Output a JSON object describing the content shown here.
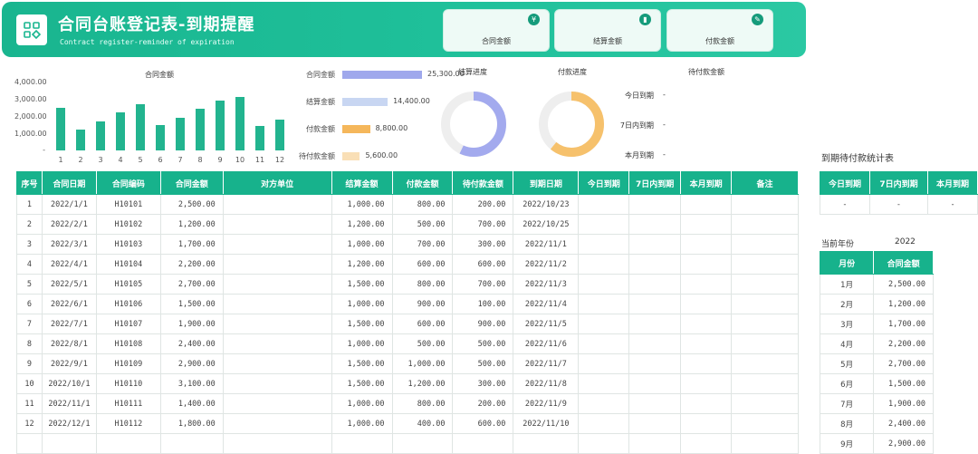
{
  "header": {
    "title": "合同台账登记表-到期提醒",
    "subtitle": "Contract register-reminder of expiration",
    "kpis": [
      {
        "label": "合同金额",
        "icon": "yen-icon"
      },
      {
        "label": "结算金额",
        "icon": "bar-chart-icon"
      },
      {
        "label": "付款金额",
        "icon": "edit-icon"
      }
    ]
  },
  "bar_chart": {
    "title": "合同金额",
    "yticks": [
      "4,000.00",
      "3,000.00",
      "2,000.00",
      "1,000.00",
      "-"
    ],
    "chart_data": {
      "type": "bar",
      "categories": [
        "1",
        "2",
        "3",
        "4",
        "5",
        "6",
        "7",
        "8",
        "9",
        "10",
        "11",
        "12"
      ],
      "values": [
        2500,
        1200,
        1700,
        2200,
        2700,
        1500,
        1900,
        2400,
        2900,
        3100,
        1400,
        1800
      ],
      "ylim": [
        0,
        4000
      ]
    }
  },
  "hbar_chart": {
    "items": [
      {
        "label": "合同金额",
        "value": "25,300.00",
        "num": 25300,
        "color": "#9fa8ec"
      },
      {
        "label": "结算金额",
        "value": "14,400.00",
        "num": 14400,
        "color": "#c8d6f2"
      },
      {
        "label": "付款金额",
        "value": "8,800.00",
        "num": 8800,
        "color": "#f5b75b"
      },
      {
        "label": "待付款金额",
        "value": "5,600.00",
        "num": 5600,
        "color": "#f9dfb6"
      }
    ]
  },
  "donuts": {
    "settle_title": "结算进度",
    "pay_title": "付款进度",
    "settle_ratio": 0.57,
    "pay_ratio": 0.61,
    "settle_color": "#a3aaee",
    "pay_color": "#f6c16c"
  },
  "pending": {
    "title": "待付款金额",
    "rows": [
      {
        "label": "今日到期",
        "value": "-"
      },
      {
        "label": "7日内到期",
        "value": "-"
      },
      {
        "label": "本月到期",
        "value": "-"
      }
    ]
  },
  "main_table": {
    "headers": [
      "序号",
      "合同日期",
      "合同编码",
      "合同金额",
      "对方单位",
      "结算金额",
      "付款金额",
      "待付款金额",
      "到期日期",
      "今日到期",
      "7日内到期",
      "本月到期",
      "备注"
    ],
    "rows": [
      [
        "1",
        "2022/1/1",
        "H10101",
        "2,500.00",
        "",
        "1,000.00",
        "800.00",
        "200.00",
        "2022/10/23",
        "",
        "",
        "",
        ""
      ],
      [
        "2",
        "2022/2/1",
        "H10102",
        "1,200.00",
        "",
        "1,200.00",
        "500.00",
        "700.00",
        "2022/10/25",
        "",
        "",
        "",
        ""
      ],
      [
        "3",
        "2022/3/1",
        "H10103",
        "1,700.00",
        "",
        "1,000.00",
        "700.00",
        "300.00",
        "2022/11/1",
        "",
        "",
        "",
        ""
      ],
      [
        "4",
        "2022/4/1",
        "H10104",
        "2,200.00",
        "",
        "1,200.00",
        "600.00",
        "600.00",
        "2022/11/2",
        "",
        "",
        "",
        ""
      ],
      [
        "5",
        "2022/5/1",
        "H10105",
        "2,700.00",
        "",
        "1,500.00",
        "800.00",
        "700.00",
        "2022/11/3",
        "",
        "",
        "",
        ""
      ],
      [
        "6",
        "2022/6/1",
        "H10106",
        "1,500.00",
        "",
        "1,000.00",
        "900.00",
        "100.00",
        "2022/11/4",
        "",
        "",
        "",
        ""
      ],
      [
        "7",
        "2022/7/1",
        "H10107",
        "1,900.00",
        "",
        "1,500.00",
        "600.00",
        "900.00",
        "2022/11/5",
        "",
        "",
        "",
        ""
      ],
      [
        "8",
        "2022/8/1",
        "H10108",
        "2,400.00",
        "",
        "1,000.00",
        "500.00",
        "500.00",
        "2022/11/6",
        "",
        "",
        "",
        ""
      ],
      [
        "9",
        "2022/9/1",
        "H10109",
        "2,900.00",
        "",
        "1,500.00",
        "1,000.00",
        "500.00",
        "2022/11/7",
        "",
        "",
        "",
        ""
      ],
      [
        "10",
        "2022/10/1",
        "H10110",
        "3,100.00",
        "",
        "1,500.00",
        "1,200.00",
        "300.00",
        "2022/11/8",
        "",
        "",
        "",
        ""
      ],
      [
        "11",
        "2022/11/1",
        "H10111",
        "1,400.00",
        "",
        "1,000.00",
        "800.00",
        "200.00",
        "2022/11/9",
        "",
        "",
        "",
        ""
      ],
      [
        "12",
        "2022/12/1",
        "H10112",
        "1,800.00",
        "",
        "1,000.00",
        "400.00",
        "600.00",
        "2022/11/10",
        "",
        "",
        "",
        ""
      ]
    ]
  },
  "due_table": {
    "title": "到期待付款统计表",
    "headers": [
      "今日到期",
      "7日内到期",
      "本月到期"
    ],
    "values": [
      "-",
      "-",
      "-"
    ]
  },
  "year_table": {
    "label": "当前年份",
    "year": "2022",
    "headers": [
      "月份",
      "合同金额"
    ],
    "rows": [
      [
        "1月",
        "2,500.00"
      ],
      [
        "2月",
        "1,200.00"
      ],
      [
        "3月",
        "1,700.00"
      ],
      [
        "4月",
        "2,200.00"
      ],
      [
        "5月",
        "2,700.00"
      ],
      [
        "6月",
        "1,500.00"
      ],
      [
        "7月",
        "1,900.00"
      ],
      [
        "8月",
        "2,400.00"
      ],
      [
        "9月",
        "2,900.00"
      ]
    ]
  }
}
